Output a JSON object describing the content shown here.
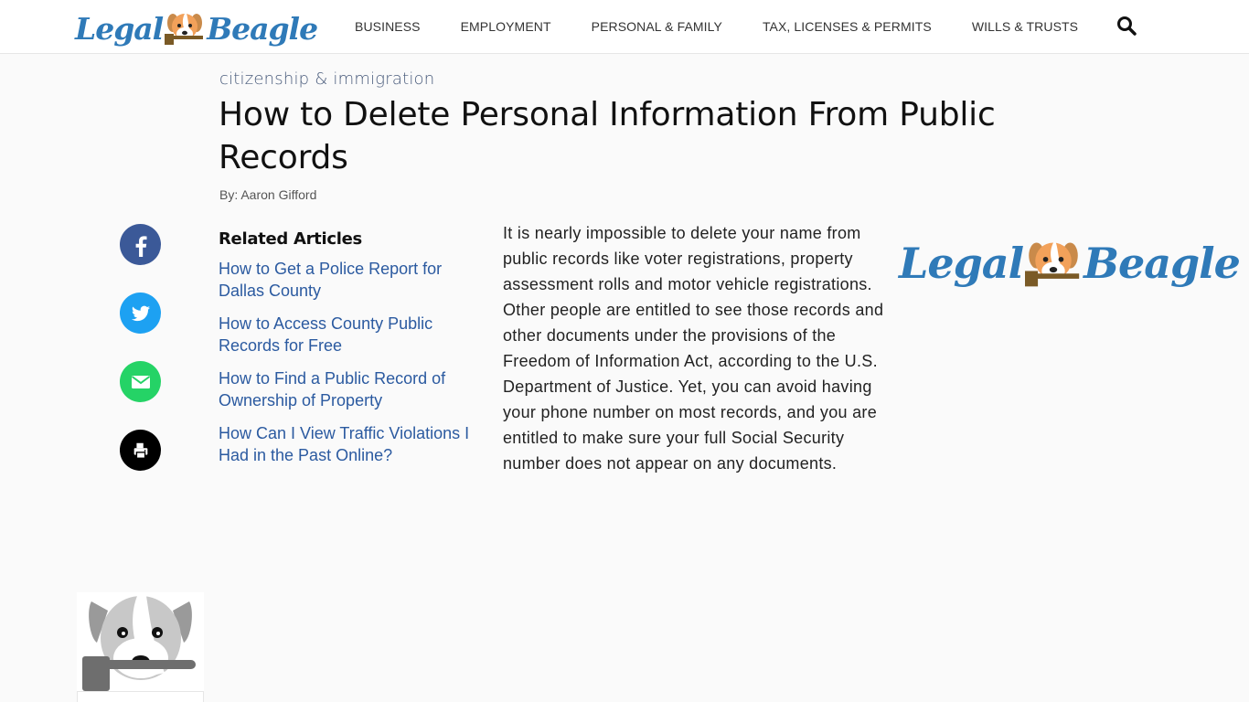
{
  "header": {
    "logo_left": "Legal",
    "logo_right": "Beagle",
    "nav": [
      {
        "label": "BUSINESS"
      },
      {
        "label": "EMPLOYMENT"
      },
      {
        "label": "PERSONAL & FAMILY"
      },
      {
        "label": "TAX, LICENSES & PERMITS"
      },
      {
        "label": "WILLS & TRUSTS"
      }
    ],
    "search_icon": "search-icon"
  },
  "article": {
    "category": "citizenship & immigration",
    "title": "How to Delete Personal Information From Public Records",
    "byline": "By: Aaron Gifford",
    "body": "It is nearly impossible to delete your name from public records like voter registrations, property assessment rolls and motor vehicle registrations. Other people are entitled to see those records and other documents under the provisions of the Freedom of Information Act, according to the U.S. Department of Justice. Yet, you can avoid having your phone number on most records, and you are entitled to make sure your full Social Security number does not appear on any documents."
  },
  "social": [
    {
      "name": "facebook",
      "color": "#3b5998"
    },
    {
      "name": "twitter",
      "color": "#1da1f2"
    },
    {
      "name": "email",
      "color": "#25d366"
    },
    {
      "name": "print",
      "color": "#000000"
    }
  ],
  "related": {
    "heading": "Related Articles",
    "links": [
      {
        "label": "How to Get a Police Report for Dallas County"
      },
      {
        "label": "How to Access County Public Records for Free"
      },
      {
        "label": "How to Find a Public Record of Ownership of Property"
      },
      {
        "label": "How Can I View Traffic Violations I Had in the Past Online?"
      }
    ]
  },
  "sidebar_logo": {
    "left": "Legal",
    "right": "Beagle"
  },
  "colors": {
    "brand_blue": "#2f7ab8",
    "link_blue": "#2b5aa0"
  }
}
